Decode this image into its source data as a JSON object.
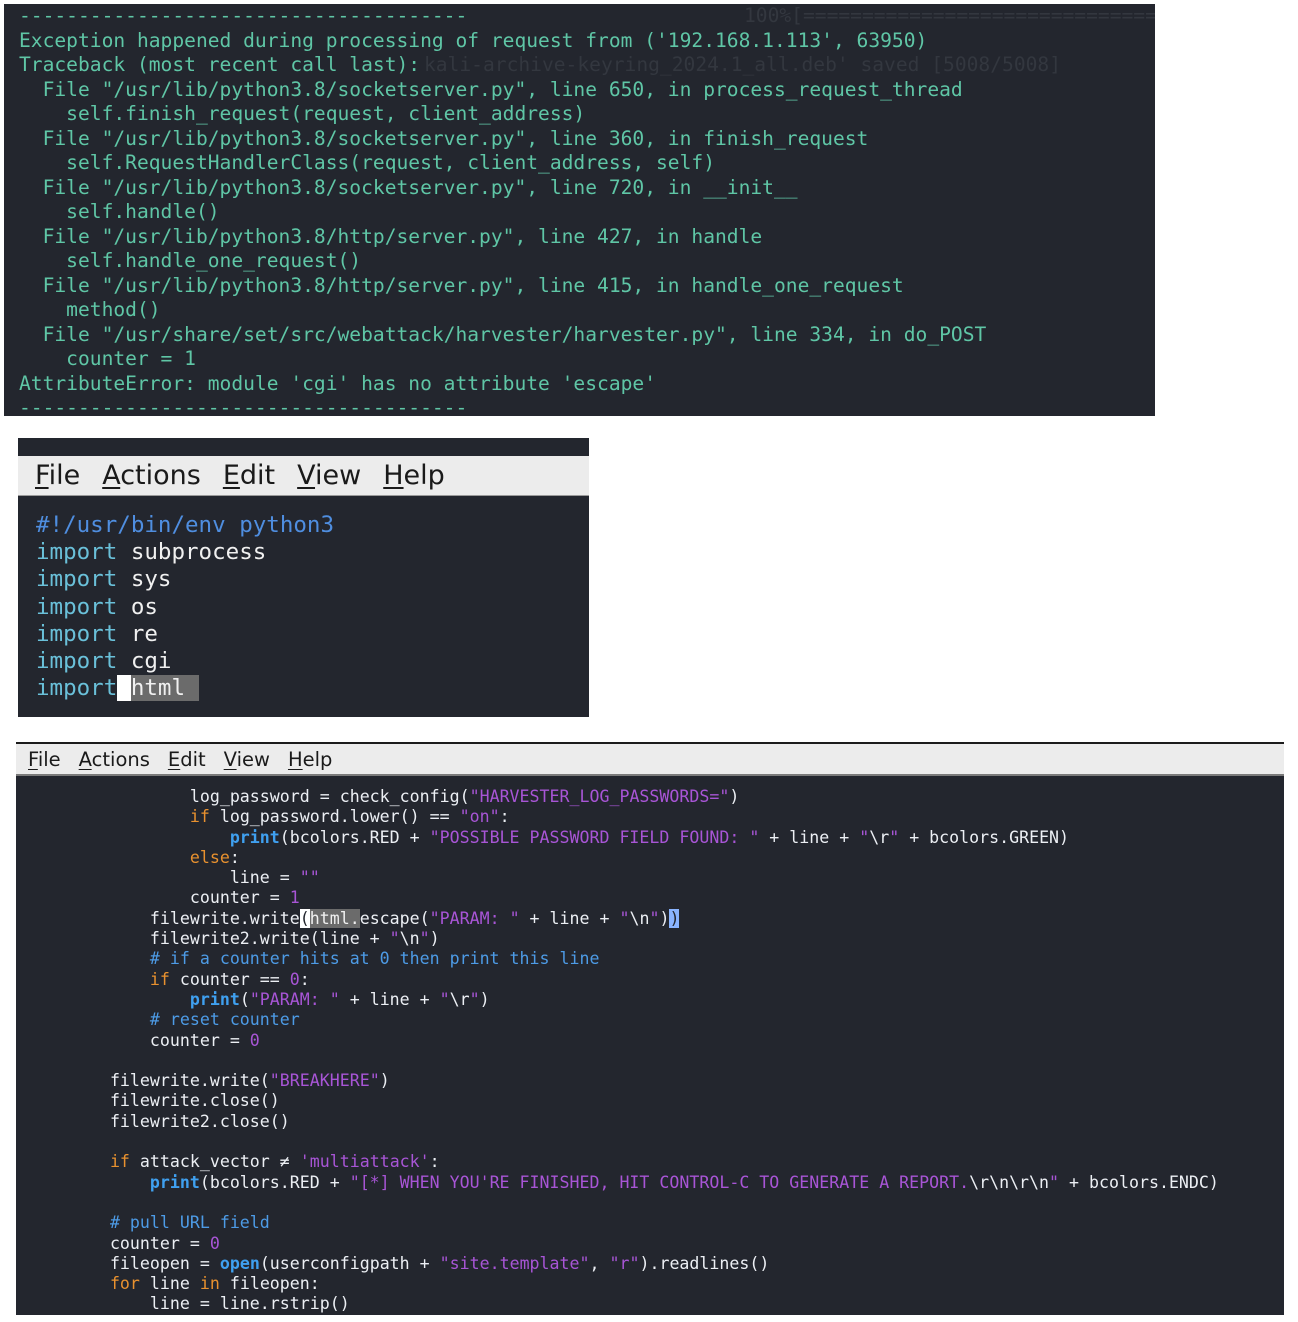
{
  "traceback_panel": {
    "lines": [
      "--------------------------------------",
      "Exception happened during processing of request from ('192.168.1.113', 63950)",
      "Traceback (most recent call last):",
      "  File \"/usr/lib/python3.8/socketserver.py\", line 650, in process_request_thread",
      "    self.finish_request(request, client_address)",
      "  File \"/usr/lib/python3.8/socketserver.py\", line 360, in finish_request",
      "    self.RequestHandlerClass(request, client_address, self)",
      "  File \"/usr/lib/python3.8/socketserver.py\", line 720, in __init__",
      "    self.handle()",
      "  File \"/usr/lib/python3.8/http/server.py\", line 427, in handle",
      "    self.handle_one_request()",
      "  File \"/usr/lib/python3.8/http/server.py\", line 415, in handle_one_request",
      "    method()",
      "  File \"/usr/share/set/src/webattack/harvester/harvester.py\", line 334, in do_POST",
      "    counter = 1",
      "AttributeError: module 'cgi' has no attribute 'escape'",
      "--------------------------------------"
    ],
    "ghost_progress": "100%[==================================",
    "ghost_saved": "kali-archive-keyring_2024.1_all.deb' saved [5008/5008]"
  },
  "menu": {
    "file": {
      "accel": "F",
      "rest": "ile"
    },
    "actions": {
      "accel": "A",
      "rest": "ctions"
    },
    "edit": {
      "accel": "E",
      "rest": "dit"
    },
    "view": {
      "accel": "V",
      "rest": "iew"
    },
    "help": {
      "accel": "H",
      "rest": "elp"
    }
  },
  "imports_panel": {
    "shebang": "#!/usr/bin/env python3",
    "keyword": "import",
    "modules": [
      "subprocess",
      "sys",
      "os",
      "re",
      "cgi"
    ],
    "last_module": "html"
  },
  "code_panel": {
    "l1": {
      "a": "log_password = check_config(",
      "s": "\"HARVESTER_LOG_PASSWORDS=\"",
      "b": ")"
    },
    "l2": {
      "kw": "if",
      "a": " log_password.lower() ",
      "op": "==",
      "sp": " ",
      "s": "\"on\"",
      "b": ":"
    },
    "l3": {
      "fn": "print",
      "a": "(bcolors.RED + ",
      "s": "\"POSSIBLE PASSWORD FIELD FOUND: \"",
      "b": " + line + ",
      "s2": "\"",
      "esc": "\\r",
      "s3": "\"",
      "c": " + bcolors.GREEN)"
    },
    "l4": {
      "kw": "else",
      "b": ":"
    },
    "l5": {
      "a": "line = ",
      "s": "\"\""
    },
    "l6": {
      "a": "counter = ",
      "n": "1"
    },
    "l7": {
      "a": "filewrite.write",
      "br": "(",
      "sel": "html.",
      "b": "escape(",
      "s": "\"PARAM: \"",
      "c": " + line + ",
      "s2": "\"",
      "esc": "\\n",
      "s3": "\"",
      "d": ")",
      "br2": ")"
    },
    "l8": {
      "a": "filewrite2.write(line + ",
      "s": "\"",
      "esc": "\\n",
      "s2": "\"",
      "b": ")"
    },
    "l9": {
      "c": "# if a counter hits at 0 then print this line"
    },
    "l10": {
      "kw": "if",
      "a": " counter ",
      "op": "==",
      "sp": " ",
      "n": "0",
      "b": ":"
    },
    "l11": {
      "fn": "print",
      "a": "(",
      "s": "\"PARAM: \"",
      "b": " + line + ",
      "s2": "\"",
      "esc": "\\r",
      "s3": "\"",
      "c": ")"
    },
    "l12": {
      "c": "# reset counter"
    },
    "l13": {
      "a": "counter = ",
      "n": "0"
    },
    "l14": {
      "a": "filewrite.write(",
      "s": "\"BREAKHERE\"",
      "b": ")"
    },
    "l15": {
      "a": "filewrite.close()"
    },
    "l16": {
      "a": "filewrite2.close()"
    },
    "l17": {
      "kw": "if",
      "a": " attack_vector ",
      "op": "≠",
      "sp": " ",
      "s": "'multiattack'",
      "b": ":"
    },
    "l18": {
      "fn": "print",
      "a": "(bcolors.RED + ",
      "s": "\"[*] WHEN YOU'RE FINISHED, HIT CONTROL-C TO GENERATE A REPORT.",
      "esc": "\\r\\n\\r\\n",
      "s2": "\"",
      "b": " + bcolors.ENDC)"
    },
    "l19": {
      "c": "# pull URL field"
    },
    "l20": {
      "a": "counter = ",
      "n": "0"
    },
    "l21": {
      "a": "fileopen = ",
      "fn": "open",
      "b": "(userconfigpath + ",
      "s": "\"site.template\"",
      "c": ", ",
      "s2": "\"r\"",
      "d": ").readlines()"
    },
    "l22": {
      "kw": "for",
      "a": " line ",
      "kw2": "in",
      "b": " fileopen:"
    },
    "l23": {
      "a": "line = line.rstrip()"
    }
  }
}
